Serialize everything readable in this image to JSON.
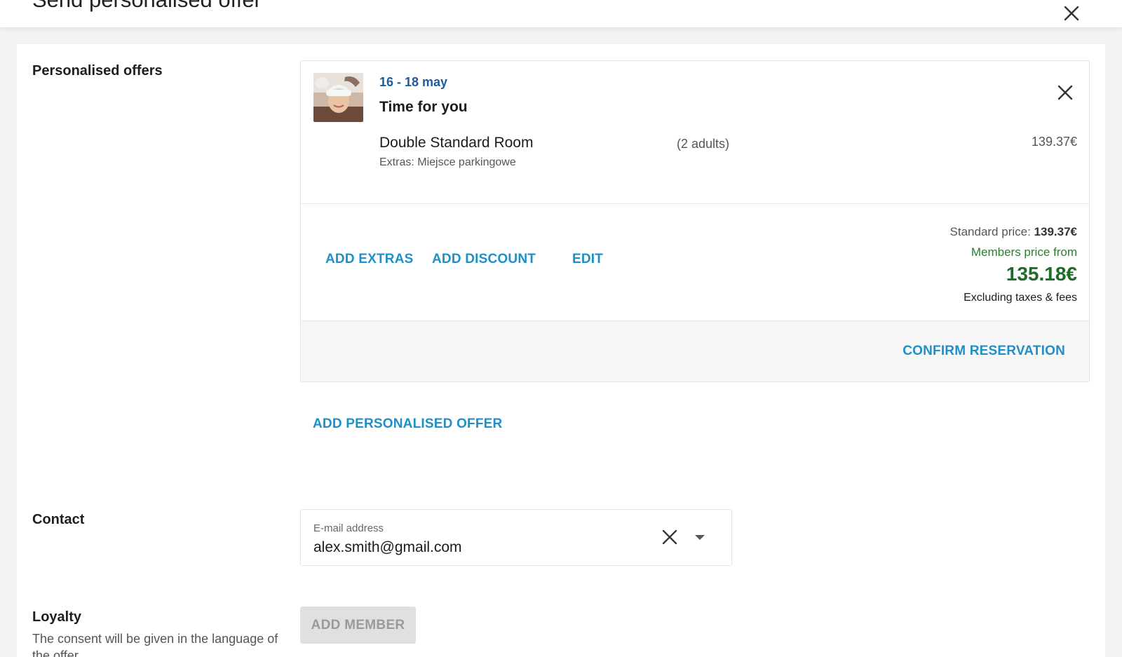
{
  "dialog": {
    "title": "Send personalised offer"
  },
  "sections": {
    "offers_label": "Personalised offers",
    "contact_label": "Contact",
    "loyalty_label": "Loyalty",
    "loyalty_note": "The consent will be given in the language of the offer"
  },
  "offer": {
    "dates": "16 - 18 may",
    "name": "Time for you",
    "room_name": "Double Standard Room",
    "guests": "(2 adults)",
    "room_price": "139.37€",
    "extras": "Extras: Miejsce parkingowe",
    "actions": {
      "add_extras": "ADD EXTRAS",
      "add_discount": "ADD DISCOUNT",
      "edit": "EDIT"
    },
    "pricing": {
      "standard_label": "Standard price:",
      "standard_value": "139.37€",
      "members_label": "Members price from",
      "members_value": "135.18€",
      "tax_note": "Excluding taxes & fees"
    },
    "confirm_label": "CONFIRM RESERVATION"
  },
  "add_offer_label": "ADD PERSONALISED OFFER",
  "contact": {
    "email_label": "E-mail address",
    "email_value": "alex.smith@gmail.com"
  },
  "loyalty": {
    "add_member_label": "ADD MEMBER"
  },
  "colors": {
    "link": "#1f8fc7",
    "date": "#1e5b9a",
    "members_green": "#2e7d32",
    "background": "#f2f3f4"
  },
  "icons": {
    "close_dialog": "close-icon",
    "remove_offer": "close-icon",
    "clear_email": "close-icon",
    "dropdown": "caret-down-icon",
    "offer_image": "spa-treatment-photo"
  }
}
